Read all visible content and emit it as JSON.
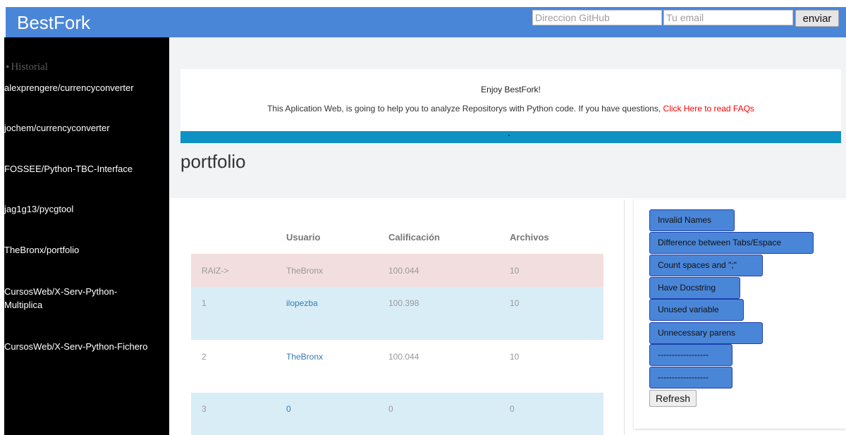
{
  "header": {
    "brand": "BestFork",
    "github_placeholder": "Direccion GitHub",
    "email_placeholder": "Tu email",
    "send_label": "enviar"
  },
  "sidebar": {
    "history_label": "Historial",
    "items": [
      {
        "label": "alexprengere/currencyconverter"
      },
      {
        "label": "jochem/currencyconverter"
      },
      {
        "label": "FOSSEE/Python-TBC-Interface"
      },
      {
        "label": "jag1g13/pycgtool"
      },
      {
        "label": "TheBronx/portfolio"
      },
      {
        "label": "CursosWeb/X-Serv-Python-Multiplica"
      },
      {
        "label": "CursosWeb/X-Serv-Python-Fichero"
      }
    ]
  },
  "banner": {
    "title": "Enjoy BestFork!",
    "text": "This Aplication Web, is going to help you to analyze Repositorys with Python code. If you have questions, ",
    "faq_link": "Click Here to read FAQs",
    "bar_dot": "."
  },
  "repo": {
    "name": "portfolio"
  },
  "table": {
    "headers": [
      "",
      "Usuario",
      "Calificación",
      "Archivos"
    ],
    "rows": [
      {
        "rank": "RAIZ->",
        "user": "TheBronx",
        "score": "100.044",
        "files": "10"
      },
      {
        "rank": "1",
        "user": "ilopezba",
        "score": "100.398",
        "files": "10"
      },
      {
        "rank": "2",
        "user": "TheBronx",
        "score": "100.044",
        "files": "10"
      },
      {
        "rank": "3",
        "user": "0",
        "score": "0",
        "files": "0"
      }
    ]
  },
  "metrics": {
    "buttons": [
      "Invalid Names",
      "Difference between Tabs/Espace",
      "Count spaces and \";\"",
      "Have Docstring",
      "Unused variable",
      "Unnecessary parens",
      "------------------",
      "------------------"
    ],
    "refresh_label": "Refresh"
  },
  "colors": {
    "accent": "#4a86d8",
    "sidebar_bg": "#000000",
    "root_row": "#f2dede",
    "info_row": "#d9edf7",
    "banner_bar": "#0e91c3",
    "link": "#337ab7",
    "faq_link": "#ff0000"
  }
}
